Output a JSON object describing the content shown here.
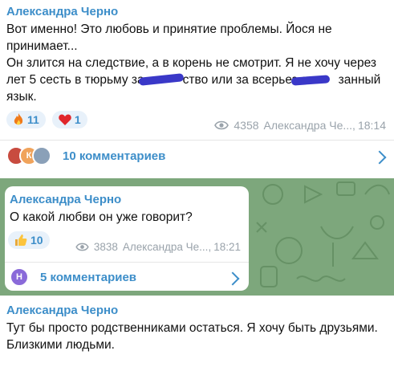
{
  "messages": [
    {
      "sender": "Александра Черно",
      "lines": [
        "Вот именно! Это любовь и принятие проблемы. Йося не",
        "принимает...",
        "Он злится на следствие, а в корень не смотрит. Я не хочу через",
        "лет 5 сесть в тюрьму за",
        "ство или за всерьез о",
        "занный",
        "язык."
      ],
      "reactions": [
        {
          "emoji_icon": "fire-icon",
          "count": "11"
        },
        {
          "emoji_icon": "heart-icon",
          "count": "1"
        }
      ],
      "views": "4358",
      "author_short": "Александра Че...,",
      "time": "18:14",
      "comments_label": "10 комментариев",
      "comment_avatar_letter": "К"
    },
    {
      "sender": "Александра Черно",
      "text": "О какой любви он уже говорит?",
      "reactions": [
        {
          "emoji_icon": "thumbs-up-icon",
          "count": "10"
        }
      ],
      "views": "3838",
      "author_short": "Александра Че...,",
      "time": "18:21",
      "comments_label": "5 комментариев",
      "comment_avatar_letter": "Н"
    },
    {
      "sender": "Александра Черно",
      "lines": [
        "Тут бы просто родственниками остаться. Я хочу быть друзьями.",
        "Близкими людьми."
      ]
    }
  ],
  "colors": {
    "accent": "#3d8ec9",
    "chat_background": "#7da77c",
    "meta": "#9aa3ab"
  }
}
